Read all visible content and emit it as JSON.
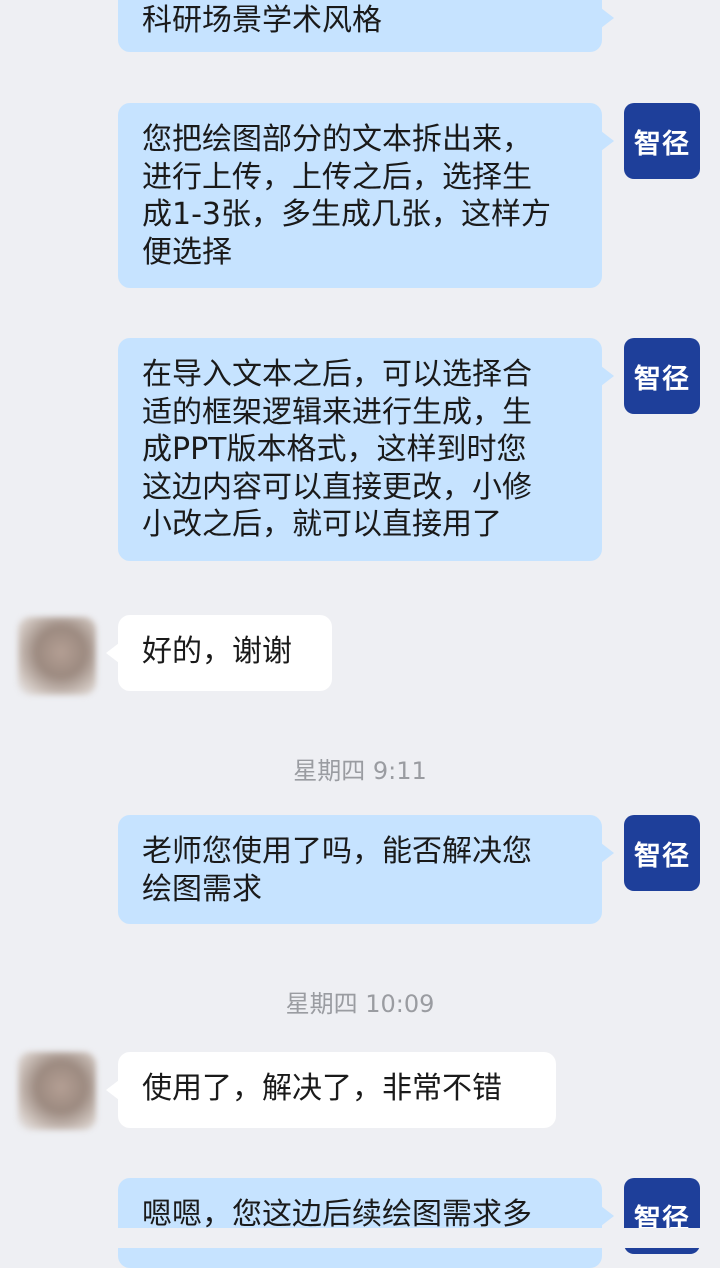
{
  "messages": [
    {
      "sender": "me",
      "avatar_label": "智径",
      "lines": [
        "科研场景学术风格"
      ]
    },
    {
      "sender": "me",
      "avatar_label": "智径",
      "lines": [
        "您把绘图部分的文本拆出来，",
        "进行上传，上传之后，选择生",
        "成1-3张，多生成几张，这样方",
        "便选择"
      ]
    },
    {
      "sender": "me",
      "avatar_label": "智径",
      "lines": [
        "在导入文本之后，可以选择合",
        "适的框架逻辑来进行生成，生",
        "成PPT版本格式，这样到时您",
        "这边内容可以直接更改，小修",
        "小改之后，就可以直接用了"
      ]
    },
    {
      "sender": "peer",
      "lines": [
        "好的，谢谢"
      ]
    },
    {
      "timestamp": "星期四  9:11"
    },
    {
      "sender": "me",
      "avatar_label": "智径",
      "lines": [
        "老师您使用了吗，能否解决您",
        "绘图需求"
      ]
    },
    {
      "timestamp": "星期四  10:09"
    },
    {
      "sender": "peer",
      "lines": [
        "使用了，解决了，非常不错"
      ]
    },
    {
      "sender": "me",
      "avatar_label": "智径",
      "lines": [
        "嗯嗯，您这边后续绘图需求多"
      ]
    }
  ],
  "colors": {
    "background": "#eeeff3",
    "outgoing_bubble": "#c6e3ff",
    "incoming_bubble": "#ffffff",
    "avatar_brand": "#1e3f9a",
    "timestamp_text": "#9a9ca1"
  }
}
